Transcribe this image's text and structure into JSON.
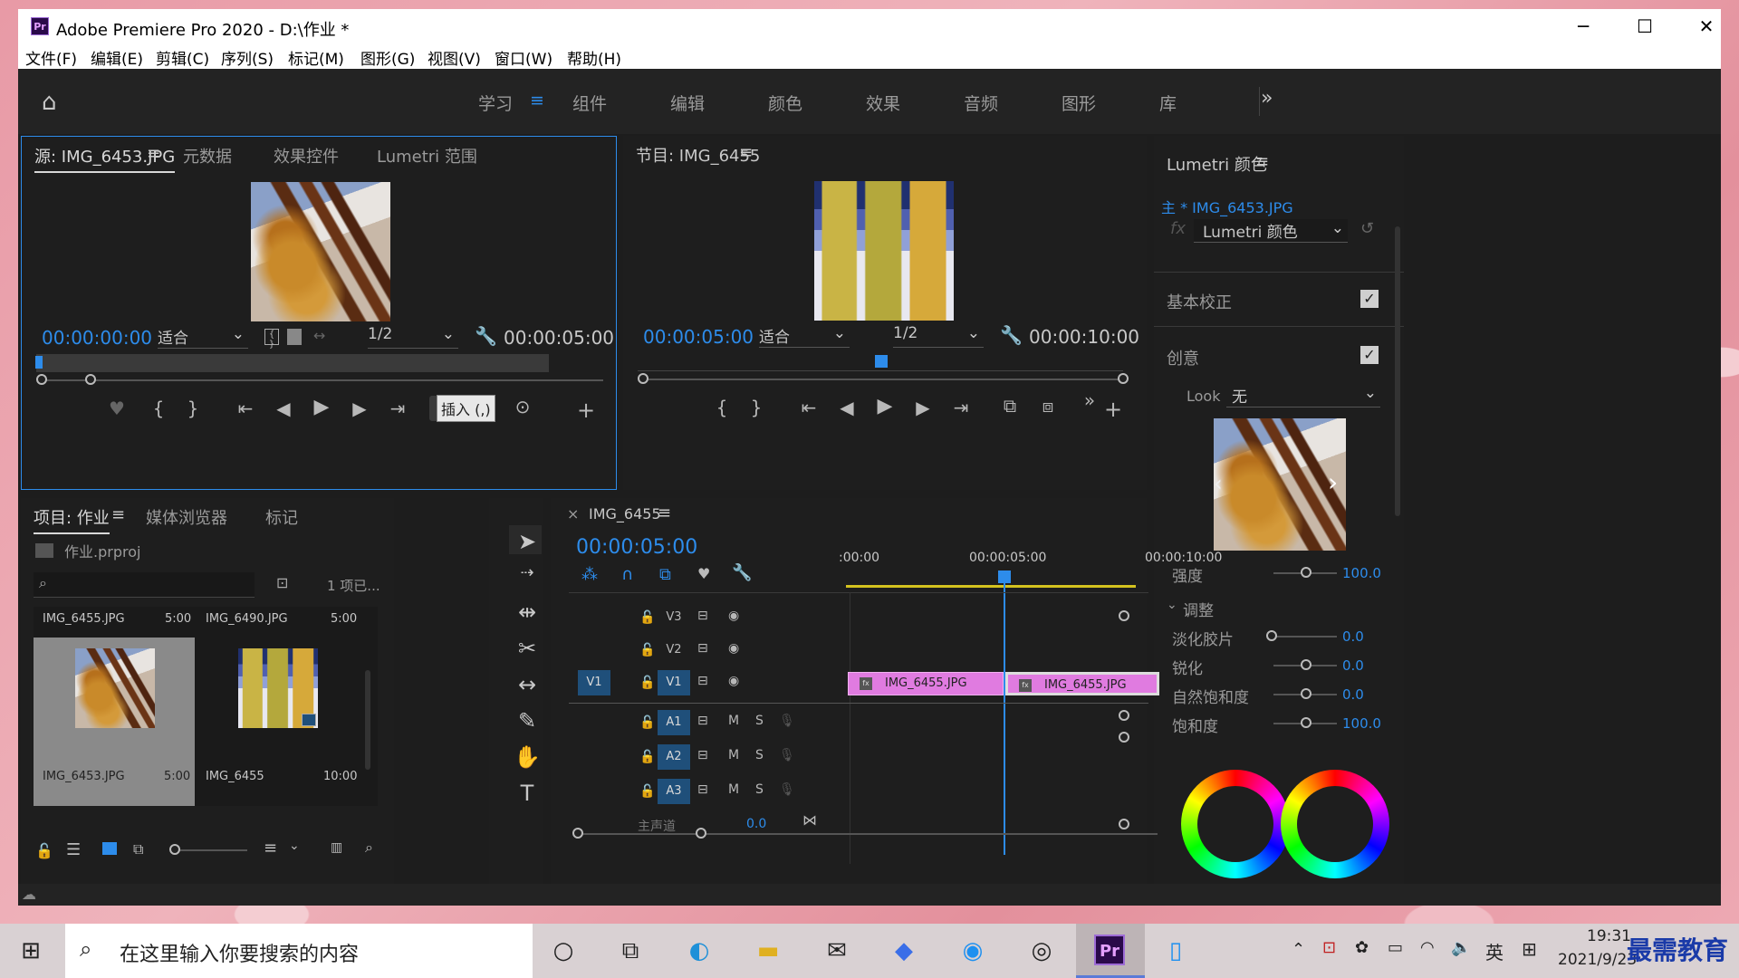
{
  "window": {
    "title": "Adobe Premiere Pro 2020 - D:\\作业 *",
    "minimize": "─",
    "maximize": "☐",
    "close": "✕"
  },
  "menu": [
    "文件(F)",
    "编辑(E)",
    "剪辑(C)",
    "序列(S)",
    "标记(M)",
    "图形(G)",
    "视图(V)",
    "窗口(W)",
    "帮助(H)"
  ],
  "workspaces": {
    "tabs": [
      "学习",
      "组件",
      "编辑",
      "颜色",
      "效果",
      "音频",
      "图形",
      "库"
    ],
    "active": "学习",
    "more": "»"
  },
  "source": {
    "tabs": [
      "源: IMG_6453.JPG",
      "元数据",
      "效果控件",
      "Lumetri 范围"
    ],
    "timecode": "00:00:00:00",
    "fit": "适合",
    "resolution": "1/2",
    "duration": "00:00:05:00"
  },
  "program": {
    "title": "节目: IMG_6455",
    "timecode": "00:00:05:00",
    "fit": "适合",
    "resolution": "1/2",
    "duration": "00:00:10:00"
  },
  "tooltip": "插入 (,)",
  "project": {
    "tabs": [
      "项目: 作业",
      "媒体浏览器",
      "标记"
    ],
    "file": "作业.prproj",
    "count": "1 项已...",
    "search_placeholder": "",
    "items": [
      {
        "name": "IMG_6455.JPG",
        "dur": "5:00"
      },
      {
        "name": "IMG_6490.JPG",
        "dur": "5:00"
      },
      {
        "name": "IMG_6453.JPG",
        "dur": "5:00"
      },
      {
        "name": "IMG_6455",
        "dur": "10:00"
      }
    ]
  },
  "timeline": {
    "close": "×",
    "name": "IMG_6455",
    "timecode": "00:00:05:00",
    "ruler": [
      ":00:00",
      "00:00:05:00",
      "00:00:10:00"
    ],
    "video_tracks": [
      "V3",
      "V2",
      "V1"
    ],
    "audio_tracks": [
      "A1",
      "A2",
      "A3"
    ],
    "source_patch": "V1",
    "master": "主声道",
    "master_val": "0.0",
    "m": "M",
    "s": "S",
    "clips": [
      "IMG_6455.JPG",
      "IMG_6455.JPG"
    ]
  },
  "lumetri": {
    "title": "Lumetri 颜色",
    "clip": "主 * IMG_6453.JPG",
    "effect": "Lumetri 颜色",
    "fx": "fx",
    "basic": "基本校正",
    "creative": "创意",
    "look_label": "Look",
    "look_value": "无",
    "intensity_label": "强度",
    "intensity": "100.0",
    "adjust": "调整",
    "rows": [
      {
        "label": "淡化胶片",
        "value": "0.0"
      },
      {
        "label": "锐化",
        "value": "0.0"
      },
      {
        "label": "自然饱和度",
        "value": "0.0"
      },
      {
        "label": "饱和度",
        "value": "100.0"
      }
    ]
  },
  "taskbar": {
    "search": "在这里输入你要搜索的内容",
    "time": "19:31",
    "date": "2021/9/23",
    "ime": "英",
    "watermark": "最需教育"
  }
}
